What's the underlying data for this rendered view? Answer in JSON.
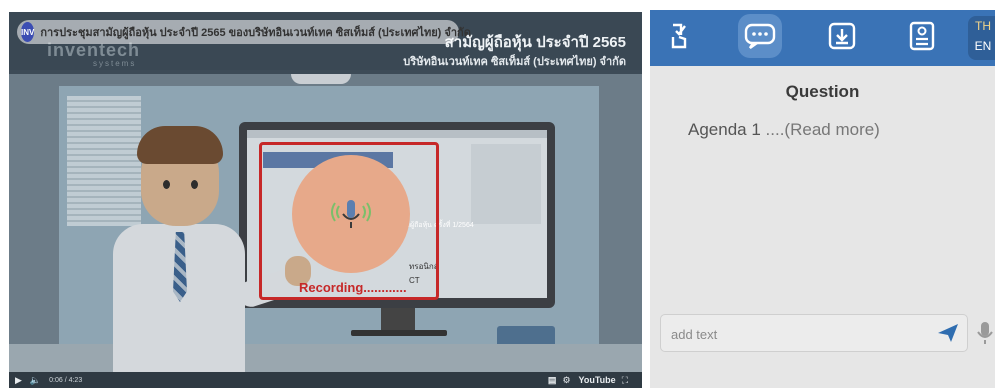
{
  "video": {
    "channel_badge": "INV",
    "title": "การประชุมสามัญผู้ถือหุ้น ประจำปี 2565 ของบริษัทอินเวนท์เทค ซิสเท็มส์ (ประเทศไทย) จำกัด",
    "brand": "inventech",
    "brand_sub": "systems",
    "header_line1": "สามัญผู้ถือหุ้น ประจำปี 2565",
    "header_line2": "บริษัทอินเวนท์เทค ซิสเท็มส์ (ประเทศไทย) จำกัด",
    "screen_title": "ารประชุมผู้ถือหุ้น ครั้งที่ 1/2564",
    "screen_text_a": "ทรอนิกส์",
    "screen_text_b": "CT",
    "recording_label": "Recording............",
    "time": "0:06 / 4:23",
    "progress": 0.023,
    "youtube_label": "YouTube"
  },
  "panel": {
    "tabs": [
      {
        "name": "vote-tab",
        "icon": "hand-vote-icon"
      },
      {
        "name": "question-tab",
        "icon": "chat-bubble-icon",
        "active": true
      },
      {
        "name": "download-tab",
        "icon": "download-icon"
      },
      {
        "name": "profile-tab",
        "icon": "id-card-icon"
      }
    ],
    "lang_th": "TH",
    "lang_en": "EN",
    "question_title": "Question",
    "agenda_label": "Agenda 1",
    "read_more": "....(Read more)",
    "input_placeholder": "add text",
    "colors": {
      "header": "#3a73b6",
      "active_tab": "#5c8ec8",
      "recording": "#c62828"
    }
  }
}
